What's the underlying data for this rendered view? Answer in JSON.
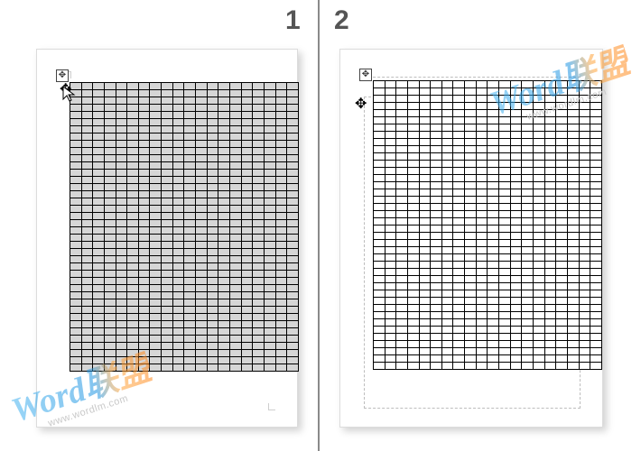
{
  "panels": {
    "left_label": "1",
    "right_label": "2"
  },
  "table": {
    "rows": 40,
    "cols": 20
  },
  "icons": {
    "move_handle": "✥",
    "move_cursor": "✥",
    "arrow_cursor": "➤"
  },
  "watermark": {
    "logo": "Word联盟",
    "url": "www.wordlm.com"
  }
}
